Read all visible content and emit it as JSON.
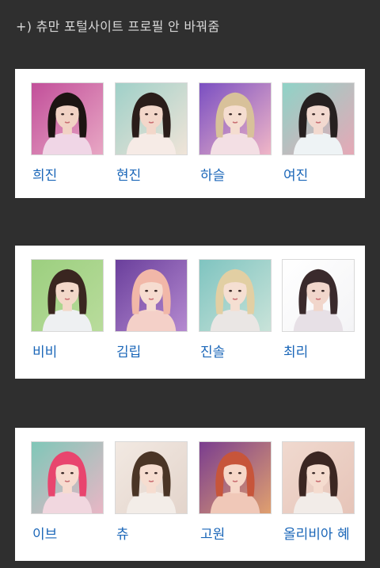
{
  "note": "+) 츄만 포털사이트 프로필 안 바꿔줌",
  "cards": [
    {
      "members": [
        {
          "name": "희진",
          "bg": "#c24f9a",
          "bg2": "#e8a7c4",
          "hair": "#1c1412",
          "skin": "#f1d2c4",
          "cloth": "#f0d6e6",
          "photo_icon": "portrait-icon"
        },
        {
          "name": "현진",
          "bg": "#9fd0c8",
          "bg2": "#f0e4d8",
          "hair": "#2a1d1a",
          "skin": "#f3d7ca",
          "cloth": "#f6ebe6",
          "photo_icon": "portrait-icon"
        },
        {
          "name": "하슬",
          "bg": "#7a4fc2",
          "bg2": "#f0b6c7",
          "hair": "#d8c19a",
          "skin": "#f5ddd0",
          "cloth": "#f3dfe4",
          "photo_icon": "portrait-icon"
        },
        {
          "name": "여진",
          "bg": "#8fd3c7",
          "bg2": "#e6a8b6",
          "hair": "#262020",
          "skin": "#f2d9cf",
          "cloth": "#eef3f5",
          "photo_icon": "portrait-icon"
        }
      ]
    },
    {
      "members": [
        {
          "name": "비비",
          "bg": "#9ccf7f",
          "bg2": "#b9dc9c",
          "hair": "#3a2620",
          "skin": "#f3d8c9",
          "cloth": "#eef0f2",
          "photo_icon": "portrait-icon"
        },
        {
          "name": "김립",
          "bg": "#6a3f9c",
          "bg2": "#b58ad0",
          "hair": "#f1b7a8",
          "skin": "#f6dcd0",
          "cloth": "#f4d0c8",
          "photo_icon": "portrait-icon"
        },
        {
          "name": "진솔",
          "bg": "#7fc4c0",
          "bg2": "#c9e3d9",
          "hair": "#e2cfa3",
          "skin": "#f5dfd2",
          "cloth": "#eae6e4",
          "photo_icon": "portrait-icon"
        },
        {
          "name": "최리",
          "bg": "#ffffff",
          "bg2": "#f4f4f6",
          "hair": "#3a2a2c",
          "skin": "#f1d6cb",
          "cloth": "#e7e0e6",
          "photo_icon": "portrait-icon"
        }
      ]
    },
    {
      "members": [
        {
          "name": "이브",
          "bg": "#7fc7b8",
          "bg2": "#e9b6c5",
          "hair": "#e8456e",
          "skin": "#f7dbcf",
          "cloth": "#f1d7df",
          "photo_icon": "portrait-icon"
        },
        {
          "name": "츄",
          "bg": "#f2e9e2",
          "bg2": "#e3d4cb",
          "hair": "#4a3526",
          "skin": "#f6ddd0",
          "cloth": "#f3ede8",
          "photo_icon": "portrait-icon"
        },
        {
          "name": "고원",
          "bg": "#7a3d8f",
          "bg2": "#e0a06f",
          "hair": "#c7553a",
          "skin": "#f6d7c8",
          "cloth": "#f0c8b8",
          "photo_icon": "portrait-icon"
        },
        {
          "name": "올리비아 혜",
          "bg": "#f0d9cf",
          "bg2": "#e6c4b8",
          "hair": "#3b2622",
          "skin": "#f5dccf",
          "cloth": "#f2ece8",
          "photo_icon": "portrait-icon"
        }
      ]
    }
  ]
}
